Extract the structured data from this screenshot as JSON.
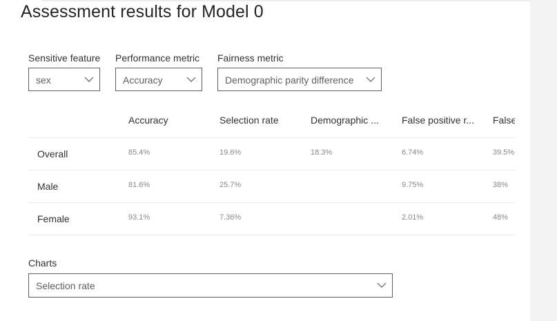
{
  "page": {
    "title": "Assessment results for Model 0"
  },
  "filters": {
    "sensitive_feature": {
      "label": "Sensitive feature",
      "value": "sex"
    },
    "performance_metric": {
      "label": "Performance metric",
      "value": "Accuracy"
    },
    "fairness_metric": {
      "label": "Fairness metric",
      "value": "Demographic parity difference"
    }
  },
  "table": {
    "columns": [
      "Accuracy",
      "Selection rate",
      "Demographic ...",
      "False positive r...",
      "False"
    ],
    "rows": [
      {
        "label": "Overall",
        "cells": [
          "85.4%",
          "19.6%",
          "18.3%",
          "6.74%",
          "39.5%"
        ]
      },
      {
        "label": "Male",
        "cells": [
          "81.6%",
          "25.7%",
          "",
          "9.75%",
          "38%"
        ]
      },
      {
        "label": "Female",
        "cells": [
          "93.1%",
          "7.36%",
          "",
          "2.01%",
          "48%"
        ]
      }
    ]
  },
  "charts": {
    "label": "Charts",
    "value": "Selection rate"
  },
  "icons": {
    "dropdown_chevron": "chevron-down-icon"
  },
  "colors": {
    "border": "#605e5c",
    "divider": "#edebe9",
    "muted_text": "#8a8886"
  }
}
